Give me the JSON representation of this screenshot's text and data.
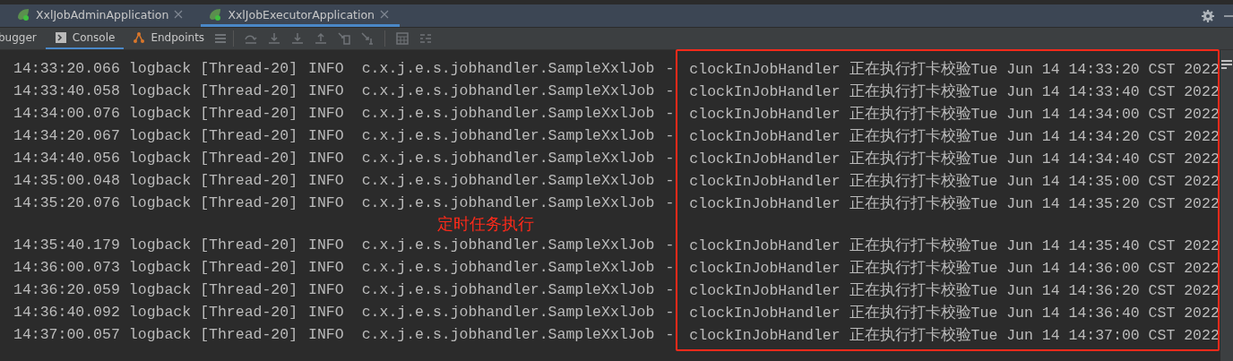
{
  "tabs": [
    {
      "label": "XxlJobAdminApplication",
      "selected": false
    },
    {
      "label": "XxlJobExecutorApplication",
      "selected": true
    }
  ],
  "tool_tabs": [
    {
      "label": "bugger",
      "kind": "text",
      "selected": false
    },
    {
      "label": "Console",
      "kind": "console",
      "selected": true
    },
    {
      "label": "Endpoints",
      "kind": "endpoints",
      "selected": false
    }
  ],
  "log_rows": [
    {
      "time": "14:33:20.066",
      "source": "logback",
      "thread": "[Thread-20]",
      "level": "INFO",
      "logger": "c.x.j.e.s.jobhandler.SampleXxlJob",
      "sep": "-",
      "message": "clockInJobHandler 正在执行打卡校验Tue Jun 14 14:33:20 CST 2022"
    },
    {
      "time": "14:33:40.058",
      "source": "logback",
      "thread": "[Thread-20]",
      "level": "INFO",
      "logger": "c.x.j.e.s.jobhandler.SampleXxlJob",
      "sep": "-",
      "message": "clockInJobHandler 正在执行打卡校验Tue Jun 14 14:33:40 CST 2022"
    },
    {
      "time": "14:34:00.076",
      "source": "logback",
      "thread": "[Thread-20]",
      "level": "INFO",
      "logger": "c.x.j.e.s.jobhandler.SampleXxlJob",
      "sep": "-",
      "message": "clockInJobHandler 正在执行打卡校验Tue Jun 14 14:34:00 CST 2022"
    },
    {
      "time": "14:34:20.067",
      "source": "logback",
      "thread": "[Thread-20]",
      "level": "INFO",
      "logger": "c.x.j.e.s.jobhandler.SampleXxlJob",
      "sep": "-",
      "message": "clockInJobHandler 正在执行打卡校验Tue Jun 14 14:34:20 CST 2022"
    },
    {
      "time": "14:34:40.056",
      "source": "logback",
      "thread": "[Thread-20]",
      "level": "INFO",
      "logger": "c.x.j.e.s.jobhandler.SampleXxlJob",
      "sep": "-",
      "message": "clockInJobHandler 正在执行打卡校验Tue Jun 14 14:34:40 CST 2022"
    },
    {
      "time": "14:35:00.048",
      "source": "logback",
      "thread": "[Thread-20]",
      "level": "INFO",
      "logger": "c.x.j.e.s.jobhandler.SampleXxlJob",
      "sep": "-",
      "message": "clockInJobHandler 正在执行打卡校验Tue Jun 14 14:35:00 CST 2022"
    },
    {
      "time": "14:35:20.076",
      "source": "logback",
      "thread": "[Thread-20]",
      "level": "INFO",
      "logger": "c.x.j.e.s.jobhandler.SampleXxlJob",
      "sep": "-",
      "message": "clockInJobHandler 正在执行打卡校验Tue Jun 14 14:35:20 CST 2022"
    },
    {
      "time": "14:35:40.179",
      "source": "logback",
      "thread": "[Thread-20]",
      "level": "INFO",
      "logger": "c.x.j.e.s.jobhandler.SampleXxlJob",
      "sep": "-",
      "message": "clockInJobHandler 正在执行打卡校验Tue Jun 14 14:35:40 CST 2022"
    },
    {
      "time": "14:36:00.073",
      "source": "logback",
      "thread": "[Thread-20]",
      "level": "INFO",
      "logger": "c.x.j.e.s.jobhandler.SampleXxlJob",
      "sep": "-",
      "message": "clockInJobHandler 正在执行打卡校验Tue Jun 14 14:36:00 CST 2022"
    },
    {
      "time": "14:36:20.059",
      "source": "logback",
      "thread": "[Thread-20]",
      "level": "INFO",
      "logger": "c.x.j.e.s.jobhandler.SampleXxlJob",
      "sep": "-",
      "message": "clockInJobHandler 正在执行打卡校验Tue Jun 14 14:36:20 CST 2022"
    },
    {
      "time": "14:36:40.092",
      "source": "logback",
      "thread": "[Thread-20]",
      "level": "INFO",
      "logger": "c.x.j.e.s.jobhandler.SampleXxlJob",
      "sep": "-",
      "message": "clockInJobHandler 正在执行打卡校验Tue Jun 14 14:36:40 CST 2022"
    },
    {
      "time": "14:37:00.057",
      "source": "logback",
      "thread": "[Thread-20]",
      "level": "INFO",
      "logger": "c.x.j.e.s.jobhandler.SampleXxlJob",
      "sep": "-",
      "message": "clockInJobHandler 正在执行打卡校验Tue Jun 14 14:37:00 CST 2022"
    }
  ],
  "annotation": {
    "text": "定时任务执行",
    "color": "#ff2a1a"
  }
}
